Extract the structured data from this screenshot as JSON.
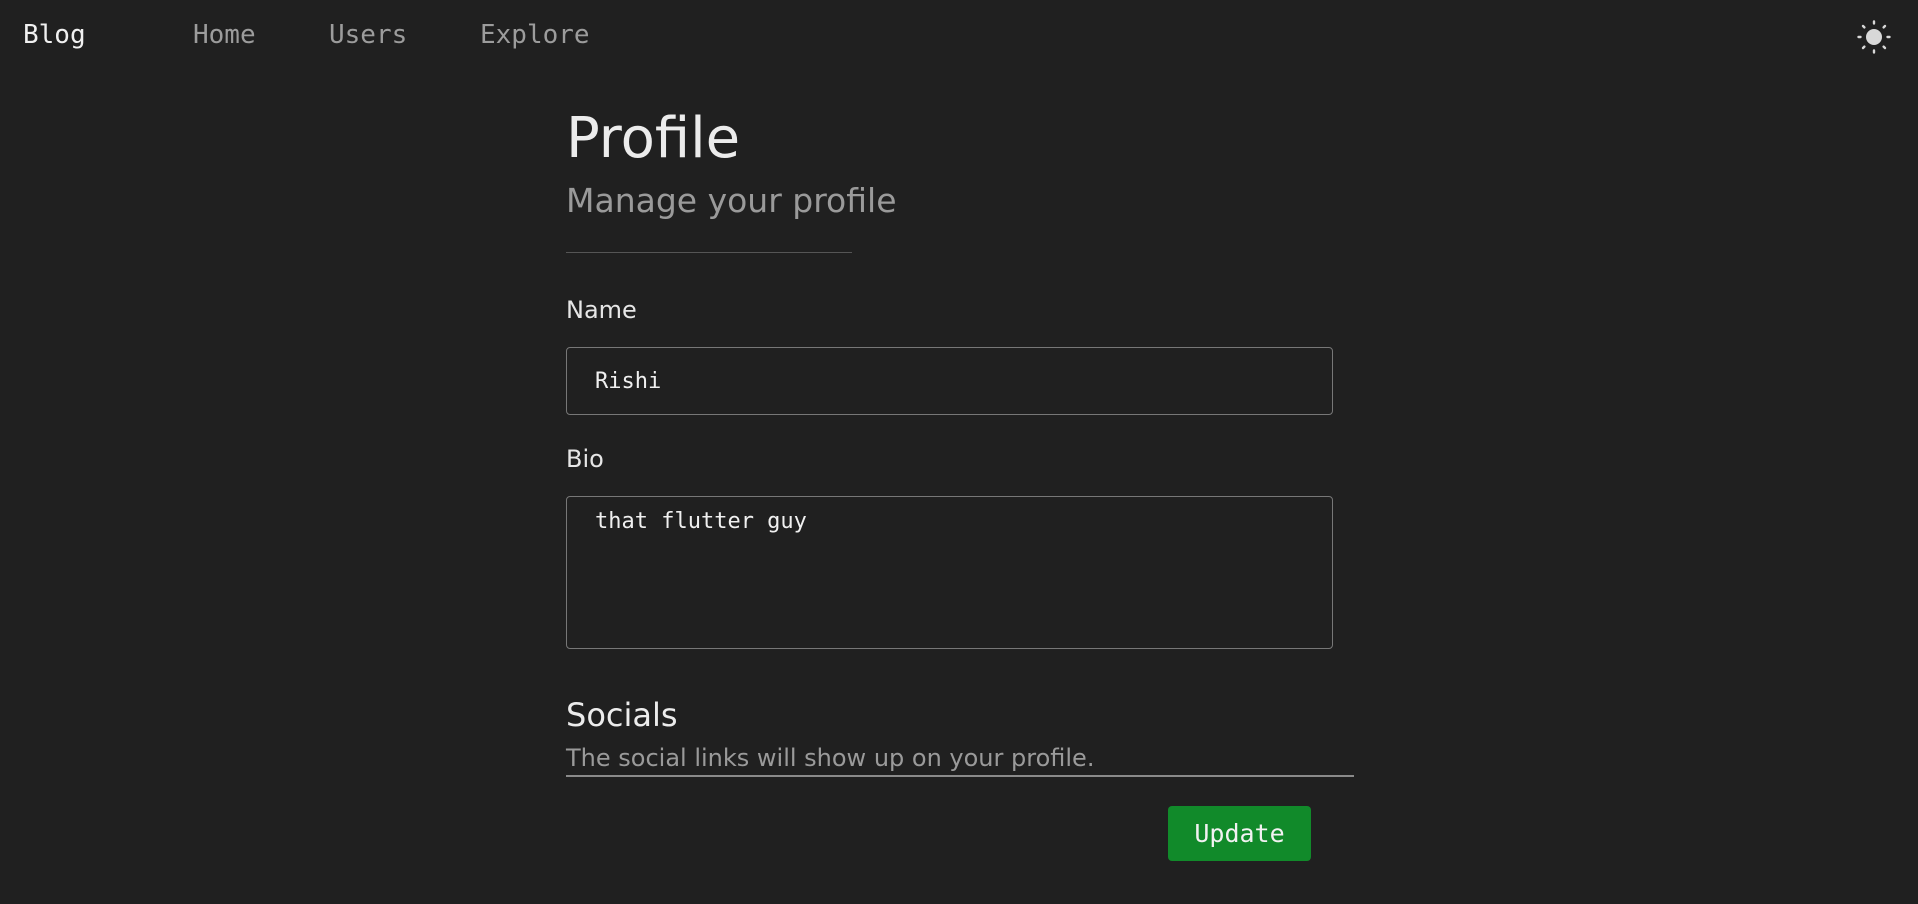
{
  "nav": {
    "brand": "Blog",
    "links": [
      "Home",
      "Users",
      "Explore"
    ],
    "theme_toggle_icon": "sun-icon"
  },
  "profile": {
    "title": "Profile",
    "subtitle": "Manage your profile"
  },
  "form": {
    "name_label": "Name",
    "name_value": "Rishi",
    "bio_label": "Bio",
    "bio_value": "that flutter guy",
    "socials_heading": "Socials",
    "socials_description": "The social links will show up on your profile.",
    "update_label": "Update"
  },
  "colors": {
    "background": "#202020",
    "primary_button": "#118a2a",
    "muted_text": "#9a9a9a"
  }
}
